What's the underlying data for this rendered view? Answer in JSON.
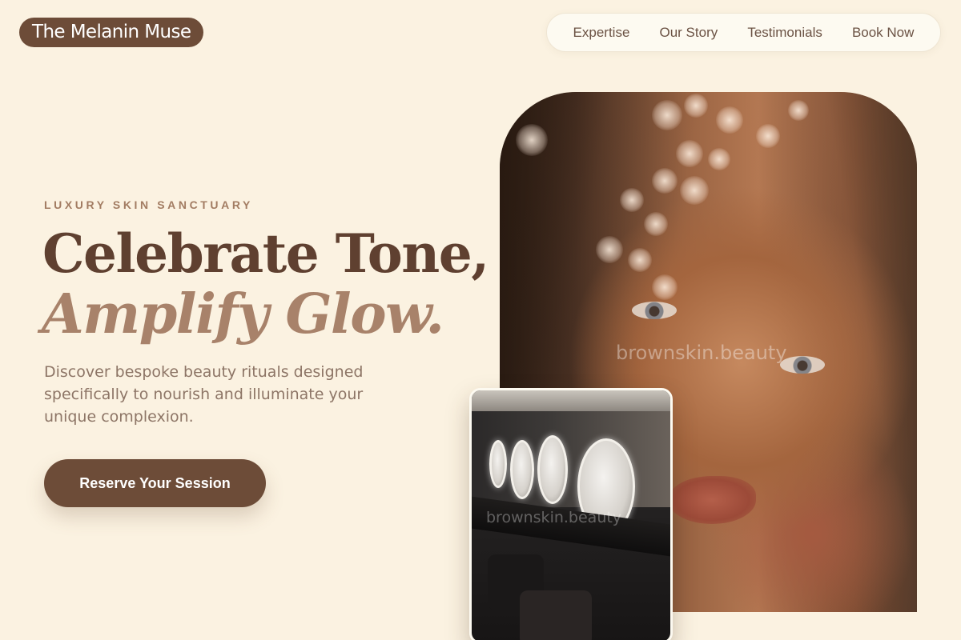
{
  "brand": {
    "name": "The Melanin Muse"
  },
  "nav": {
    "items": [
      {
        "label": "Expertise"
      },
      {
        "label": "Our Story"
      },
      {
        "label": "Testimonials"
      },
      {
        "label": "Book Now"
      }
    ]
  },
  "hero": {
    "eyebrow": "LUXURY SKIN SANCTUARY",
    "headline_line1": "Celebrate Tone,",
    "headline_line2": "Amplify Glow.",
    "description": "Discover bespoke beauty rituals designed specifically to nourish and illuminate your unique complexion.",
    "cta_label": "Reserve Your Session"
  },
  "images": {
    "portrait_watermark": "brownskin.beauty",
    "salon_watermark": "brownskin.beauty"
  },
  "colors": {
    "background": "#fbf2e1",
    "brand_brown": "#6d4c38",
    "headline_dark": "#5f4030",
    "headline_accent": "#a8826a",
    "eyebrow": "#a27c62",
    "body_text": "#8d7566"
  }
}
